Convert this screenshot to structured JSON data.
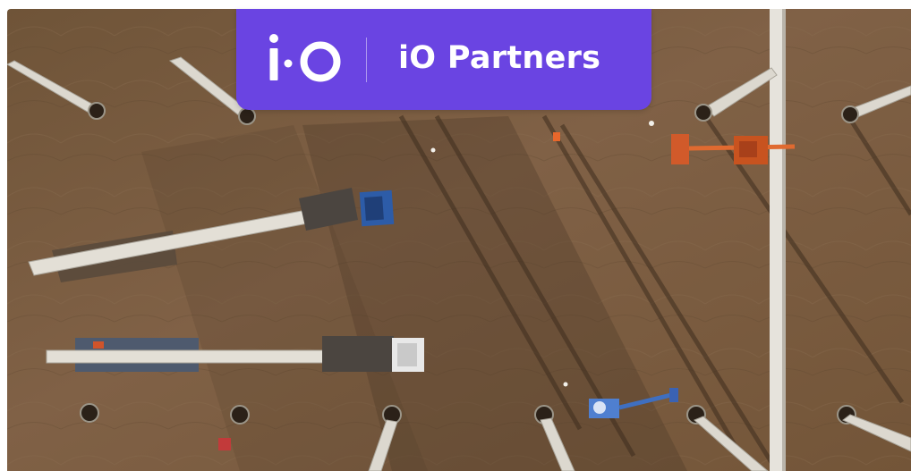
{
  "badge": {
    "logo_mark": "i·O",
    "brand_name": "iO Partners",
    "background": "#6A44E2",
    "text_color": "#FFFFFF"
  },
  "photo": {
    "subject": "aerial-construction-site-photo",
    "ground_color": "#7A5C3E",
    "shadow_color": "#4E3A27"
  }
}
